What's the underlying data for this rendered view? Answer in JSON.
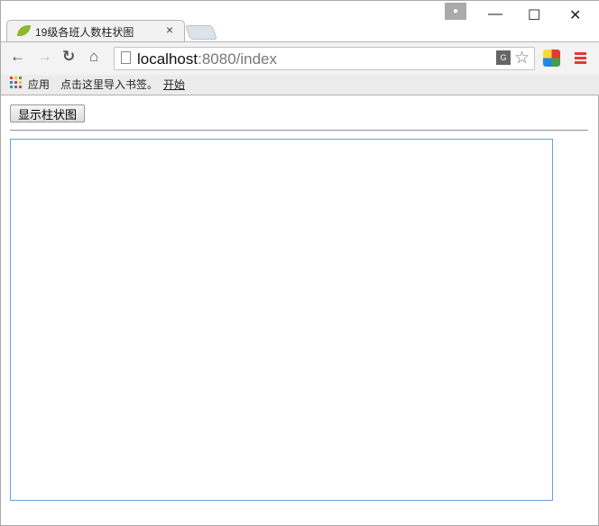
{
  "browser": {
    "tab_title": "19级各班人数柱状图",
    "tab_close": "×",
    "url_host": "localhost",
    "url_rest": ":8080/index",
    "window_controls": {
      "minimize": "—",
      "maximize": "☐",
      "close": "✕"
    },
    "nav": {
      "back": "←",
      "forward": "→",
      "reload": "↻",
      "home": "⌂"
    },
    "bookmarks": [
      "应用",
      "点击这里导入书签。",
      "开始"
    ]
  },
  "page": {
    "show_button": "显示柱状图"
  }
}
